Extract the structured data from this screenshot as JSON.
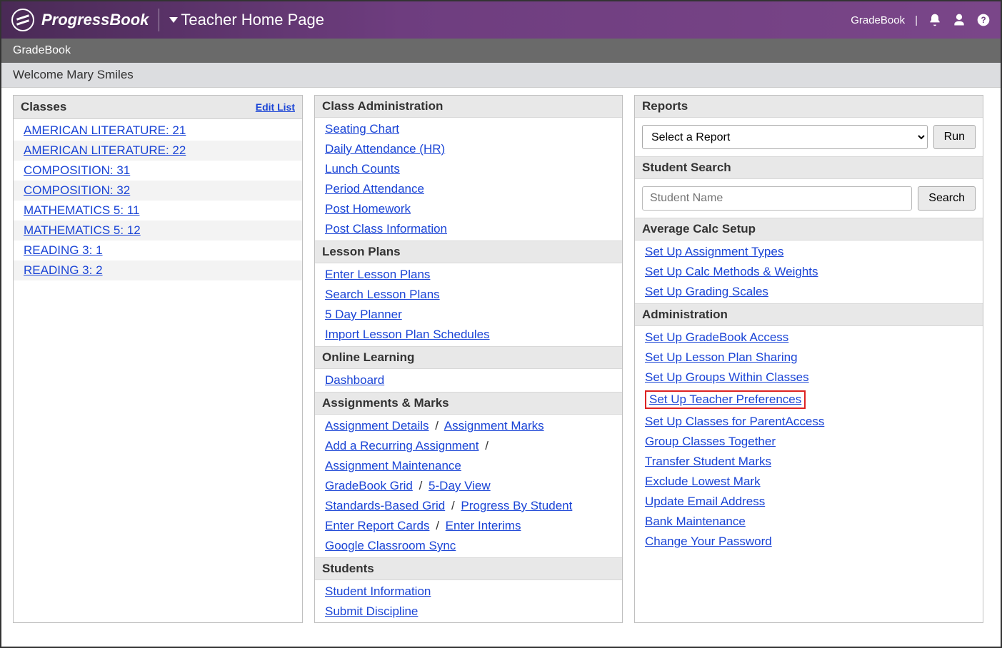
{
  "header": {
    "logo_text": "ProgressBook",
    "page_title": "Teacher Home Page",
    "right_label": "GradeBook"
  },
  "subbar": {
    "label": "GradeBook"
  },
  "welcome": {
    "text": "Welcome Mary Smiles"
  },
  "classes": {
    "title": "Classes",
    "edit_link": "Edit List",
    "items": [
      "AMERICAN LITERATURE: 21",
      "AMERICAN LITERATURE: 22",
      "COMPOSITION: 31",
      "COMPOSITION: 32",
      "MATHEMATICS 5: 11",
      "MATHEMATICS 5: 12",
      "READING 3: 1",
      "READING 3: 2"
    ]
  },
  "col2": {
    "class_admin": {
      "title": "Class Administration",
      "links": [
        "Seating Chart",
        "Daily Attendance (HR)",
        "Lunch Counts",
        "Period Attendance",
        "Post Homework",
        "Post Class Information"
      ]
    },
    "lesson_plans": {
      "title": "Lesson Plans",
      "links": [
        "Enter Lesson Plans",
        "Search Lesson Plans",
        "5 Day Planner",
        "Import Lesson Plan Schedules"
      ]
    },
    "online_learning": {
      "title": "Online Learning",
      "links": [
        "Dashboard"
      ]
    },
    "assignments": {
      "title": "Assignments & Marks",
      "row1": {
        "a": "Assignment Details",
        "b": "Assignment Marks"
      },
      "row2": {
        "a": "Add a Recurring Assignment"
      },
      "row3": {
        "a": "Assignment Maintenance"
      },
      "row4": {
        "a": "GradeBook Grid",
        "b": "5-Day View"
      },
      "row5": {
        "a": "Standards-Based Grid",
        "b": "Progress By Student"
      },
      "row6": {
        "a": "Enter Report Cards",
        "b": "Enter Interims"
      },
      "row7": {
        "a": "Google Classroom Sync"
      }
    },
    "students": {
      "title": "Students",
      "links": [
        "Student Information",
        "Submit Discipline"
      ]
    }
  },
  "col3": {
    "reports": {
      "title": "Reports",
      "select_placeholder": "Select a Report",
      "run_label": "Run"
    },
    "student_search": {
      "title": "Student Search",
      "placeholder": "Student Name",
      "button": "Search"
    },
    "avg_calc": {
      "title": "Average Calc Setup",
      "links": [
        "Set Up Assignment Types",
        "Set Up Calc Methods & Weights",
        "Set Up Grading Scales"
      ]
    },
    "admin": {
      "title": "Administration",
      "links": [
        "Set Up GradeBook Access",
        "Set Up Lesson Plan Sharing",
        "Set Up Groups Within Classes",
        "Set Up Teacher Preferences",
        "Set Up Classes for ParentAccess",
        "Group Classes Together",
        "Transfer Student Marks",
        "Exclude Lowest Mark",
        "Update Email Address",
        "Bank Maintenance",
        "Change Your Password"
      ],
      "highlighted_index": 3
    }
  }
}
